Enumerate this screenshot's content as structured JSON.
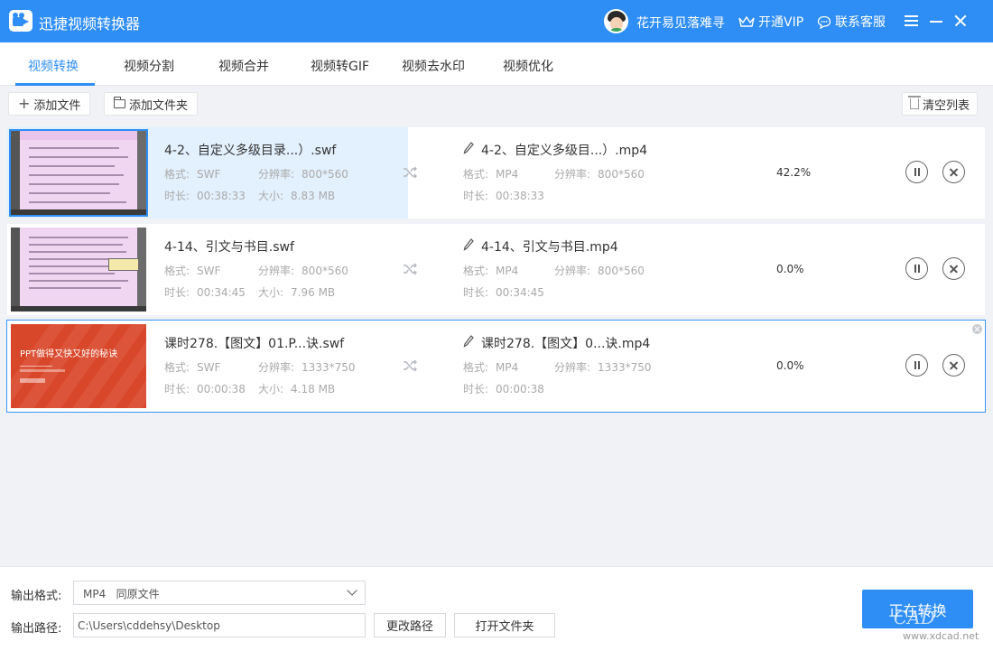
{
  "app": {
    "title": "迅捷视频转换器",
    "user": "花开易见落难寻",
    "vip": "开通VIP",
    "support": "联系客服"
  },
  "tabs": [
    {
      "label": "视频转换",
      "active": true
    },
    {
      "label": "视频分割"
    },
    {
      "label": "视频合并"
    },
    {
      "label": "视频转GIF"
    },
    {
      "label": "视频去水印"
    },
    {
      "label": "视频优化"
    }
  ],
  "toolbar": {
    "add_file": "添加文件",
    "add_folder": "添加文件夹",
    "clear_list": "清空列表"
  },
  "labels": {
    "format": "格式:",
    "resolution": "分辨率:",
    "duration": "时长:",
    "size": "大小:"
  },
  "files": [
    {
      "src_name": "4-2、自定义多级目录...）.swf",
      "src_format": "SWF",
      "src_resolution": "800*560",
      "src_duration": "00:38:33",
      "src_size": "8.83 MB",
      "dst_name": "4-2、自定义多级目...）.mp4",
      "dst_format": "MP4",
      "dst_resolution": "800*560",
      "dst_duration": "00:38:33",
      "progress": "42.2%"
    },
    {
      "src_name": "4-14、引文与书目.swf",
      "src_format": "SWF",
      "src_resolution": "800*560",
      "src_duration": "00:34:45",
      "src_size": "7.96 MB",
      "dst_name": "4-14、引文与书目.mp4",
      "dst_format": "MP4",
      "dst_resolution": "800*560",
      "dst_duration": "00:34:45",
      "progress": "0.0%"
    },
    {
      "src_name": "课时278.【图文】01.P...诀.swf",
      "src_format": "SWF",
      "src_resolution": "1333*750",
      "src_duration": "00:00:38",
      "src_size": "4.18 MB",
      "dst_name": "课时278.【图文】0...诀.mp4",
      "dst_format": "MP4",
      "dst_resolution": "1333*750",
      "dst_duration": "00:00:38",
      "progress": "0.0%",
      "thumb_title": "PPT做得又快又好的秘诀"
    }
  ],
  "footer": {
    "format_label": "输出格式:",
    "format_value": "MP4   同原文件",
    "path_label": "输出路径:",
    "path_value": "C:\\Users\\cddehsy\\Desktop",
    "change_path": "更改路径",
    "open_folder": "打开文件夹",
    "start": "正在转换"
  },
  "watermark": {
    "logo": "CAD",
    "url": "www.xdcad.net"
  },
  "colors": {
    "accent": "#2f8ef5",
    "progress_fill": "#e3f0fd",
    "ppt_red": "#d9472b"
  }
}
